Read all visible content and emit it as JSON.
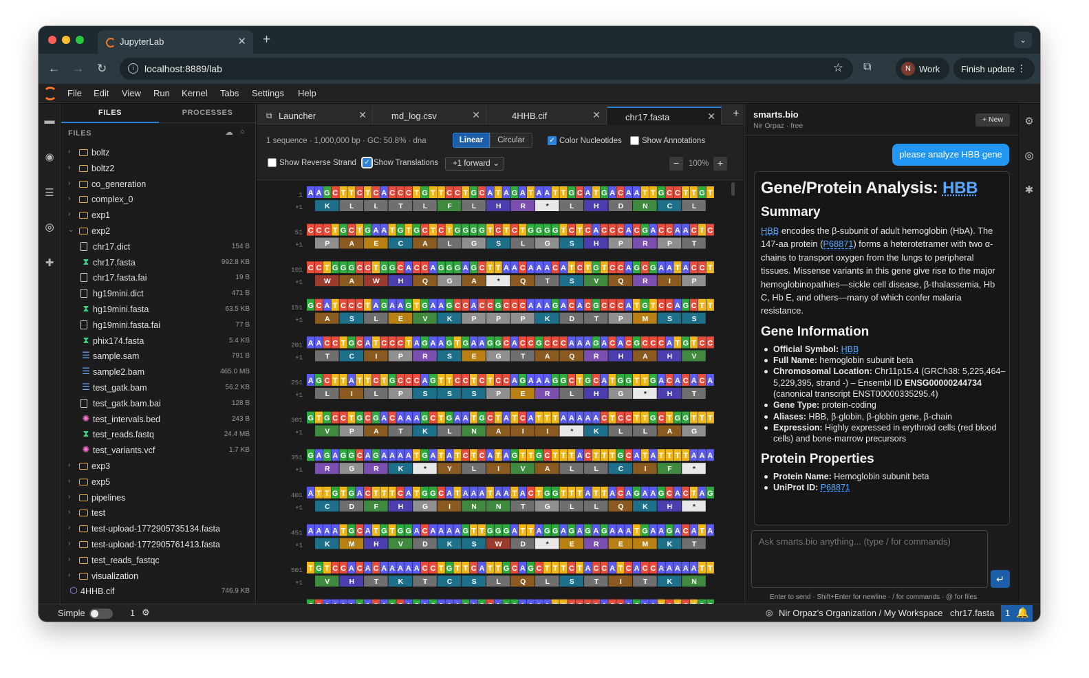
{
  "browser": {
    "tab_title": "JupyterLab",
    "url": "localhost:8889/lab",
    "profile_initial": "N",
    "profile_name": "Work",
    "update_button": "Finish update"
  },
  "jupyter": {
    "menu": [
      "File",
      "Edit",
      "View",
      "Run",
      "Kernel",
      "Tabs",
      "Settings",
      "Help"
    ]
  },
  "filebrowser": {
    "tabs": [
      "FILES",
      "PROCESSES"
    ],
    "header": "FILES",
    "items": [
      {
        "name": "boltz",
        "type": "folder",
        "size": "",
        "depth": 0,
        "expanded": false
      },
      {
        "name": "boltz2",
        "type": "folder",
        "size": "",
        "depth": 0,
        "expanded": false
      },
      {
        "name": "co_generation",
        "type": "folder",
        "size": "",
        "depth": 0,
        "expanded": false
      },
      {
        "name": "complex_0",
        "type": "folder",
        "size": "",
        "depth": 0,
        "expanded": false
      },
      {
        "name": "exp1",
        "type": "folder",
        "size": "",
        "depth": 0,
        "expanded": false
      },
      {
        "name": "exp2",
        "type": "folder",
        "size": "",
        "depth": 0,
        "expanded": true
      },
      {
        "name": "chr17.dict",
        "type": "file",
        "size": "154 B",
        "depth": 1
      },
      {
        "name": "chr17.fasta",
        "type": "dna",
        "size": "992.8 KB",
        "depth": 1
      },
      {
        "name": "chr17.fasta.fai",
        "type": "file",
        "size": "19 B",
        "depth": 1
      },
      {
        "name": "hg19mini.dict",
        "type": "file",
        "size": "471 B",
        "depth": 1
      },
      {
        "name": "hg19mini.fasta",
        "type": "dna",
        "size": "63.5 KB",
        "depth": 1
      },
      {
        "name": "hg19mini.fasta.fai",
        "type": "file",
        "size": "77 B",
        "depth": 1
      },
      {
        "name": "phix174.fasta",
        "type": "dna",
        "size": "5.4 KB",
        "depth": 1
      },
      {
        "name": "sample.sam",
        "type": "align",
        "size": "791 B",
        "depth": 1
      },
      {
        "name": "sample2.bam",
        "type": "align",
        "size": "465.0 MB",
        "depth": 1
      },
      {
        "name": "test_gatk.bam",
        "type": "align",
        "size": "56.2 KB",
        "depth": 1
      },
      {
        "name": "test_gatk.bam.bai",
        "type": "file",
        "size": "128 B",
        "depth": 1
      },
      {
        "name": "test_intervals.bed",
        "type": "bed",
        "size": "243 B",
        "depth": 1
      },
      {
        "name": "test_reads.fastq",
        "type": "dna",
        "size": "24.4 MB",
        "depth": 1
      },
      {
        "name": "test_variants.vcf",
        "type": "bed",
        "size": "1.7 KB",
        "depth": 1
      },
      {
        "name": "exp3",
        "type": "folder",
        "size": "",
        "depth": 0,
        "expanded": false
      },
      {
        "name": "exp5",
        "type": "folder",
        "size": "",
        "depth": 0,
        "expanded": false
      },
      {
        "name": "pipelines",
        "type": "folder",
        "size": "",
        "depth": 0,
        "expanded": false
      },
      {
        "name": "test",
        "type": "folder",
        "size": "",
        "depth": 0,
        "expanded": false
      },
      {
        "name": "test-upload-1772905735134.fasta",
        "type": "folder",
        "size": "",
        "depth": 0,
        "expanded": false
      },
      {
        "name": "test-upload-1772905761413.fasta",
        "type": "folder",
        "size": "",
        "depth": 0,
        "expanded": false
      },
      {
        "name": "test_reads_fastqc",
        "type": "folder",
        "size": "",
        "depth": 0,
        "expanded": false
      },
      {
        "name": "visualization",
        "type": "folder",
        "size": "",
        "depth": 0,
        "expanded": false
      },
      {
        "name": "4HHB.cif",
        "type": "mol",
        "size": "746.9 KB",
        "depth": -1
      }
    ]
  },
  "editor": {
    "tabs": [
      {
        "label": "Launcher",
        "active": false
      },
      {
        "label": "md_log.csv",
        "active": false
      },
      {
        "label": "4HHB.cif",
        "active": false
      },
      {
        "label": "chr17.fasta",
        "active": true
      }
    ],
    "info": "1 sequence · 1,000,000 bp · GC: 50.8% · dna",
    "view_linear": "Linear",
    "view_circular": "Circular",
    "color_nucleotides": "Color Nucleotides",
    "show_annotations": "Show Annotations",
    "show_reverse": "Show Reverse Strand",
    "show_translations": "Show Translations",
    "frame_select": "+1 forward",
    "zoom": "100%",
    "frame_label": "+1",
    "base_colors": {
      "A": "#5b5bf0",
      "C": "#e74c3c",
      "G": "#2eaa3f",
      "T": "#f0b71a"
    },
    "rows": [
      {
        "pos": "1",
        "seq": "AAGCTTCTCACCCTGTTCCTGCATAGATAATTGCATGACAATTGCCTTGT",
        "aa": "KLLTLFLHR*LHDNCLV"
      },
      {
        "pos": "51",
        "seq": "CCCTGCTGAATGTGCTCTGGGGTCTCTGGGGTCTCACCCACGACCAACTC",
        "aa": "PAECALGSLGSHPRPT"
      },
      {
        "pos": "101",
        "seq": "CCTGGGCCTGGCACCAGGGAGCTTAACAAACATCTGTCCAGCGAATACCT",
        "aa": "WAWHQGA*QTSVQRIP"
      },
      {
        "pos": "151",
        "seq": "GCATCCCTAGAAGTGAAGCCACCGCCCAAAGACACGCCCATGTCCAGCTT",
        "aa": "ASLEVKPPPKDTPMSSL"
      },
      {
        "pos": "201",
        "seq": "AACCTGCATCCCTAGAAGTGAAGGCACCGCCCAAAGACACGCCCATGTCC",
        "aa": "TCIPRSEGTAQRHAHV"
      },
      {
        "pos": "251",
        "seq": "AGCTTATTCTGCCCAGTTCCTCTCCAGAAAGGCTGCATGGTTGACACACA",
        "aa": "LILPSSSPERLHG*HT"
      },
      {
        "pos": "301",
        "seq": "GTGCCTGCGACAAAGCTGAATGCTATCATTTAAAAACTCCTTGCTGGTTT",
        "aa": "VPATKLNAII*KLLAGL"
      },
      {
        "pos": "351",
        "seq": "GAGAGGCAGAAAATGATATCTCATAGTTGCTTTACTTTGCATATTTTAAA",
        "aa": "RGRK*YLIVALLCIF*"
      },
      {
        "pos": "401",
        "seq": "ATTGTGACTTTCATGGCATAAATAATACTGGTTTATTACAGAAGCACTAG",
        "aa": "CDFHGINNTGLLQKH*"
      },
      {
        "pos": "451",
        "seq": "AAAATGCATGTGGACAAAAGTTGGGATTAGGAGAGAGAAATGAAGACATA",
        "aa": "KMHVDKSWD*EREMKTY"
      },
      {
        "pos": "501",
        "seq": "TGTCCACACAAAAACCTGTTCATTGCAGCTTTCTACCATCACCAAAAATT",
        "aa": "VHTKTCSLQLSTITKN"
      },
      {
        "pos": "",
        "seq": "GCAAAAGACAGCAGAGAAAGAGCAGGAAAATTCCCCACCAGAATCTCTGG",
        "aa": ""
      }
    ]
  },
  "assistant": {
    "title": "smarts.bio",
    "subtitle": "Nir Orpaz · free",
    "new_button": "+ New",
    "user_message": "please analyze HBB gene",
    "heading_prefix": "Gene/Protein Analysis: ",
    "heading_link": "HBB",
    "summary_title": "Summary",
    "summary_link1": "HBB",
    "summary_text1": " encodes the β-subunit of adult hemoglobin (HbA). The 147-aa protein (",
    "summary_link2": "P68871",
    "summary_text2": ") forms a heterotetramer with two α-chains to transport oxygen from the lungs to peripheral tissues. Missense variants in this gene give rise to the major hemoglobinopathies—sickle cell disease, β-thalassemia, Hb C, Hb E, and others—many of which confer malaria resistance.",
    "gene_info_title": "Gene Information",
    "gi_symbol_label": "Official Symbol: ",
    "gi_symbol_link": "HBB",
    "gi_fullname_label": "Full Name: ",
    "gi_fullname": "hemoglobin subunit beta",
    "gi_loc_label": "Chromosomal Location: ",
    "gi_loc": "Chr11p15.4 (GRCh38: 5,225,464–5,229,395, strand -) – Ensembl ID ",
    "gi_ensembl": "ENSG00000244734",
    "gi_loc2": " (canonical transcript ENST00000335295.4)",
    "gi_type_label": "Gene Type: ",
    "gi_type": "protein-coding",
    "gi_alias_label": "Aliases: ",
    "gi_alias": "HBB, β-globin, β-globin gene, β-chain",
    "gi_expr_label": "Expression: ",
    "gi_expr": "Highly expressed in erythroid cells (red blood cells) and bone-marrow precursors",
    "protein_title": "Protein Properties",
    "pp_name_label": "Protein Name: ",
    "pp_name": "Hemoglobin subunit beta",
    "pp_uniprot_label": "UniProt ID: ",
    "pp_uniprot": "P68871",
    "input_placeholder": "Ask smarts.bio anything... (type / for commands)",
    "hint": "Enter to send · Shift+Enter for newline · / for commands · @ for files"
  },
  "status": {
    "mode": "Simple",
    "kernels": "1",
    "workspace": "Nir Orpaz's Organization / My Workspace",
    "file": "chr17.fasta",
    "notifications": "1"
  }
}
